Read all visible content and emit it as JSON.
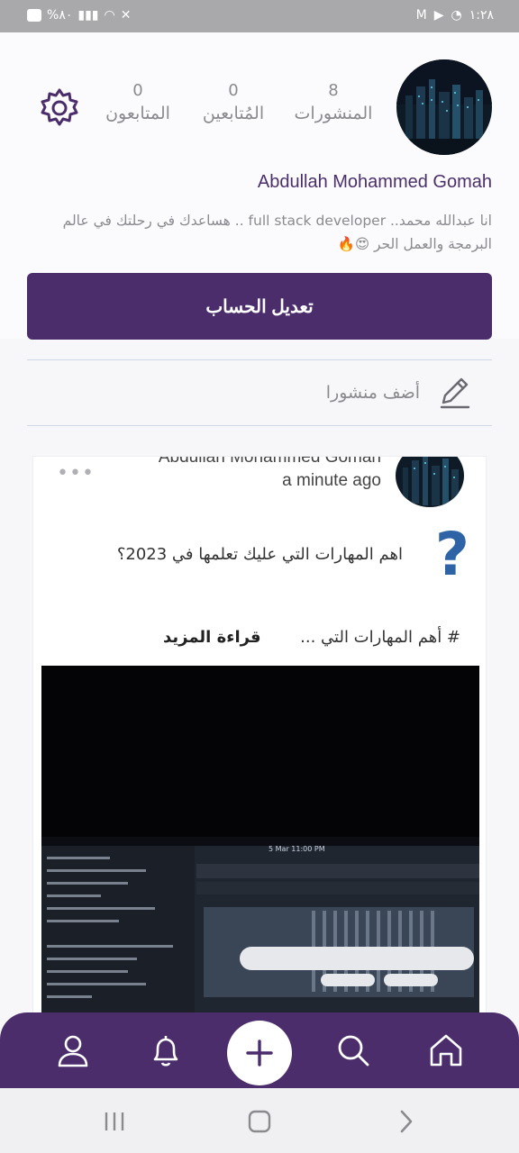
{
  "status_bar": {
    "left_text": "%٨٠",
    "time": "١:٢٨"
  },
  "profile": {
    "display_name": "Abdullah Mohammed Gomah",
    "bio": "انا عبدالله محمد.. full stack developer .. هساعدك في رحلتك في عالم البرمجة والعمل الحر 😍🔥",
    "stats": [
      {
        "value": "8",
        "label": "المنشورات"
      },
      {
        "value": "0",
        "label": "المُتابعين"
      },
      {
        "value": "0",
        "label": "المتابعون"
      }
    ],
    "edit_button": "تعديل الحساب"
  },
  "composer": {
    "placeholder": "أضف منشورا"
  },
  "post": {
    "author": "Abdullah Mohammed Gomah",
    "time": "a minute ago",
    "more": "•••",
    "qmark": "?",
    "title": "اهم المهارات التي عليك تعلمها في 2023؟",
    "preview": "# أهم المهارات التي ...",
    "read_more": "قراءة المزيد",
    "image_caption": "5 Mar 11:00 PM"
  },
  "bottom_nav": {
    "items": [
      "profile",
      "notifications",
      "add",
      "search",
      "home"
    ]
  },
  "icons": {
    "settings": "gear-icon",
    "pencil": "pencil-icon",
    "profile": "user-icon",
    "notifications": "bell-icon",
    "add": "plus-icon",
    "search": "search-icon",
    "home": "home-icon"
  },
  "colors": {
    "primary": "#4b2d6c",
    "accent_blue": "#2e64a5",
    "muted_text": "#8a8a8f"
  }
}
